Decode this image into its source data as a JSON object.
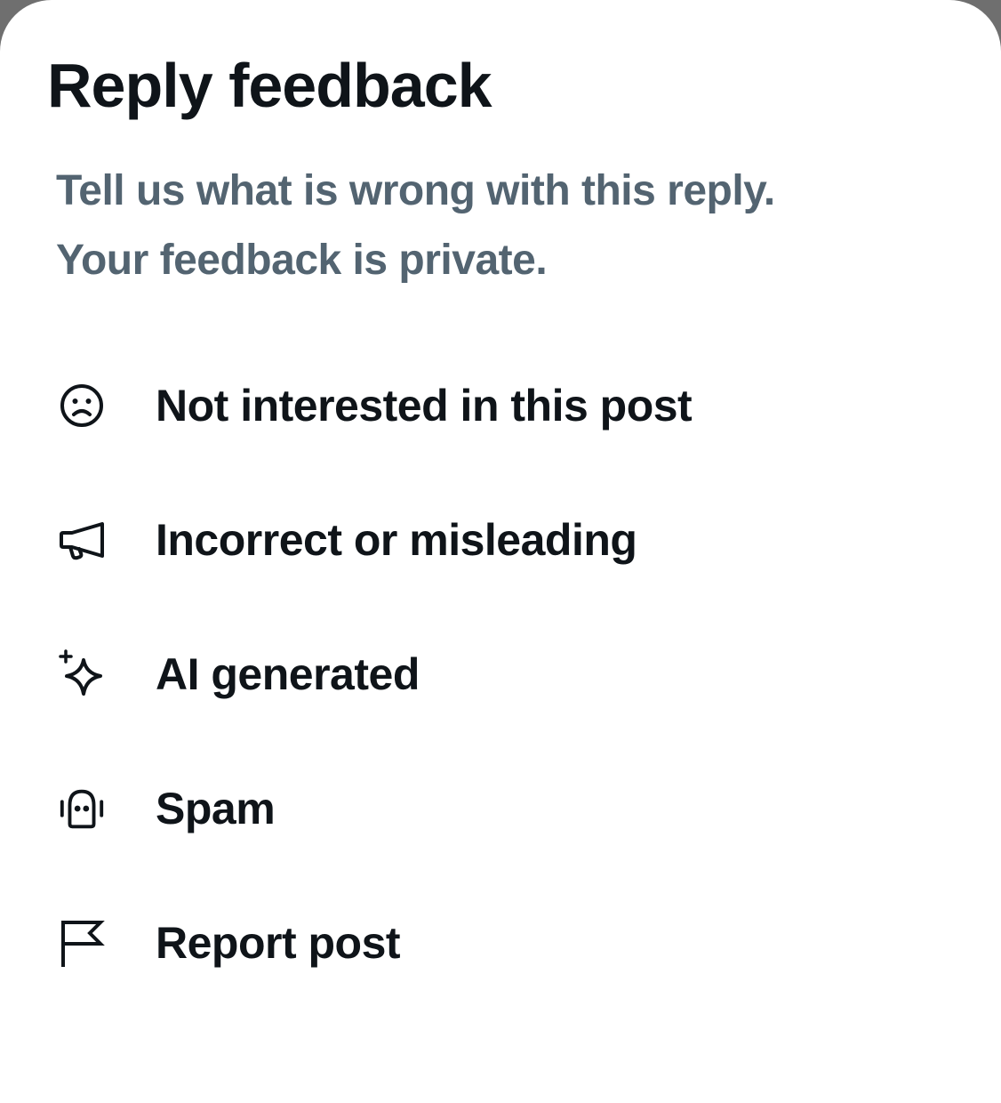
{
  "dialog": {
    "title": "Reply feedback",
    "subtitle_line1": "Tell us what is wrong with this reply.",
    "subtitle_line2": "Your feedback is private."
  },
  "options": [
    {
      "label": "Not interested in this post",
      "icon": "frown-face-icon"
    },
    {
      "label": "Incorrect or misleading",
      "icon": "megaphone-icon"
    },
    {
      "label": "AI generated",
      "icon": "sparkle-icon"
    },
    {
      "label": "Spam",
      "icon": "robot-icon"
    },
    {
      "label": "Report post",
      "icon": "flag-icon"
    }
  ],
  "colors": {
    "title": "#0f1419",
    "subtitle": "#536471",
    "background": "#ffffff",
    "backdrop": "#6f6f6f"
  }
}
